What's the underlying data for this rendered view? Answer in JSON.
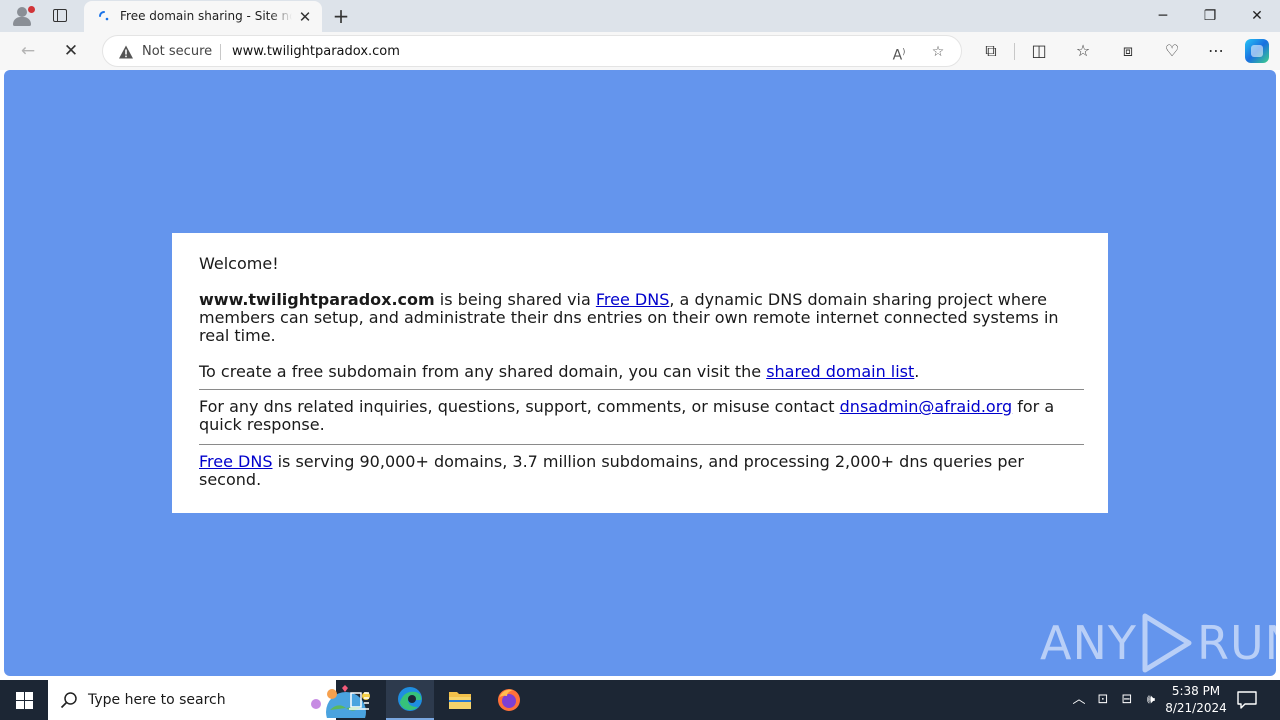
{
  "browser": {
    "tab_title": "Free domain sharing - Site not yet configured",
    "tab_close": "✕",
    "new_tab": "+",
    "window_controls": {
      "minimize": "─",
      "restore": "❐",
      "close": "✕"
    },
    "nav": {
      "back": "←",
      "stop": "✕"
    },
    "security_label": "Not secure",
    "url": "www.twilightparadox.com"
  },
  "page": {
    "background_color": "#6495ed",
    "welcome": "Welcome!",
    "p1": {
      "domain": "www.twilightparadox.com",
      "pre_link": " is being shared via ",
      "link": "Free DNS",
      "post_link": ", a dynamic DNS domain sharing project where members can setup, and administrate their dns entries on their own remote internet connected systems in real time."
    },
    "p2": {
      "pre_link": "To create a free subdomain from any shared domain, you can visit the ",
      "link": "shared domain list",
      "post_link": "."
    },
    "p3": {
      "pre_link": "For any dns related inquiries, questions, support, comments, or misuse contact ",
      "link": "dnsadmin@afraid.org",
      "post_link": " for a quick response."
    },
    "p4": {
      "link": "Free DNS",
      "post_link": " is serving 90,000+ domains, 3.7 million subdomains, and processing 2,000+ dns queries per second."
    },
    "watermark": {
      "left": "ANY",
      "right": "RUN"
    }
  },
  "taskbar": {
    "search_placeholder": "Type here to search",
    "time": "5:38 PM",
    "date": "8/21/2024"
  }
}
